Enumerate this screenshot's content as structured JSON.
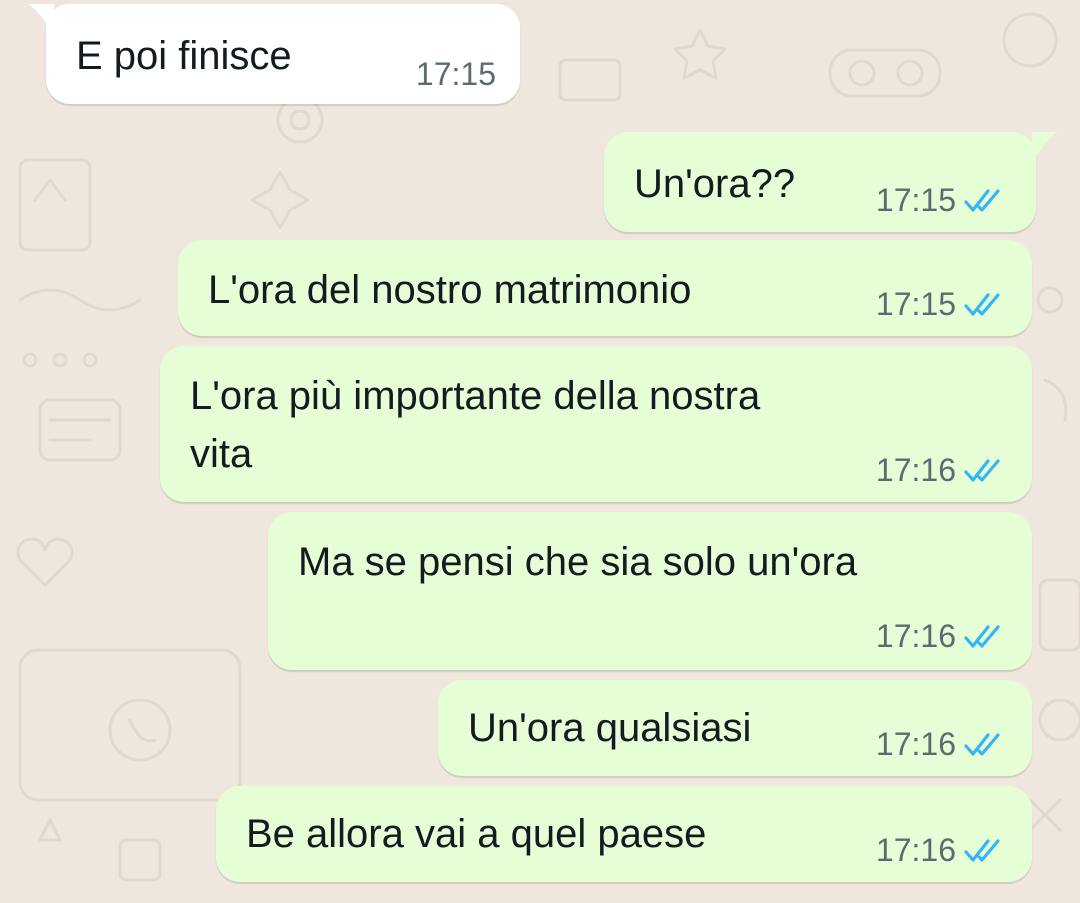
{
  "colors": {
    "background": "#efe7de",
    "incoming_bubble": "#ffffff",
    "outgoing_bubble": "#e6fed6",
    "read_ticks": "#34b7f1",
    "text": "#111b21",
    "timestamp": "#5b6b74"
  },
  "messages": [
    {
      "direction": "incoming",
      "lines": [
        "E poi finisce"
      ],
      "time": "17:15"
    },
    {
      "direction": "outgoing",
      "lines": [
        "Un'ora??"
      ],
      "time": "17:15",
      "status": "read"
    },
    {
      "direction": "outgoing",
      "lines": [
        "L'ora del nostro matrimonio"
      ],
      "time": "17:15",
      "status": "read"
    },
    {
      "direction": "outgoing",
      "lines": [
        "L'ora più importante della nostra",
        "vita"
      ],
      "time": "17:16",
      "status": "read"
    },
    {
      "direction": "outgoing",
      "lines": [
        "Ma se pensi che sia solo un'ora"
      ],
      "time": "17:16",
      "status": "read"
    },
    {
      "direction": "outgoing",
      "lines": [
        "Un'ora qualsiasi"
      ],
      "time": "17:16",
      "status": "read"
    },
    {
      "direction": "outgoing",
      "lines": [
        "Be allora vai a quel paese"
      ],
      "time": "17:16",
      "status": "read"
    }
  ]
}
